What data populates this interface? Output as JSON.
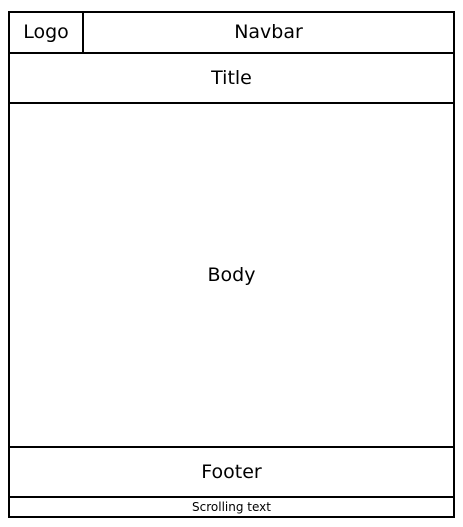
{
  "header": {
    "logo_label": "Logo",
    "navbar_label": "Navbar"
  },
  "title": {
    "label": "Title"
  },
  "body": {
    "label": "Body"
  },
  "footer": {
    "label": "Footer"
  },
  "scrolling": {
    "label": "Scrolling text"
  }
}
